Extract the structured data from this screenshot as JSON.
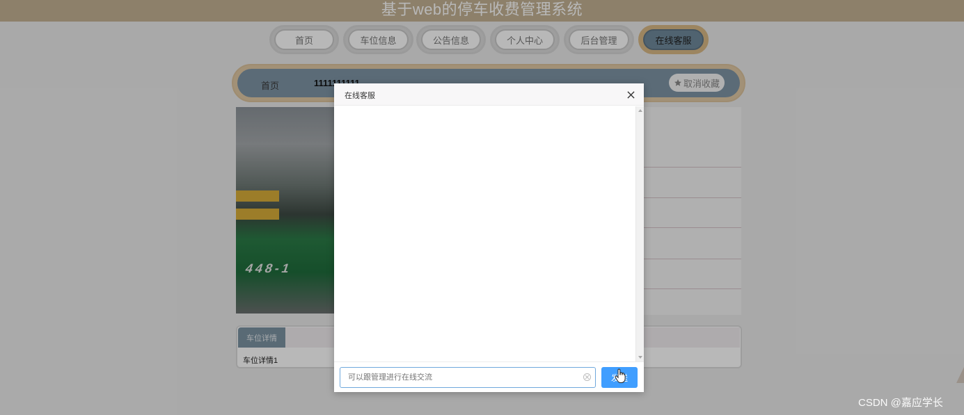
{
  "header": {
    "title": "基于web的停车收费管理系统"
  },
  "nav": {
    "items": [
      {
        "label": "首页",
        "active": false
      },
      {
        "label": "车位信息",
        "active": false
      },
      {
        "label": "公告信息",
        "active": false
      },
      {
        "label": "个人中心",
        "active": false
      },
      {
        "label": "后台管理",
        "active": false
      },
      {
        "label": "在线客服",
        "active": true
      }
    ]
  },
  "breadcrumb": {
    "home": "首页",
    "current": "1111111111"
  },
  "favorite": {
    "label": "取消收藏",
    "icon": "star-icon"
  },
  "photo": {
    "label": "448-1"
  },
  "detail": {
    "tab_label": "车位详情",
    "content": "车位详情1"
  },
  "dialog": {
    "title": "在线客服",
    "close_icon": "close-icon",
    "input_placeholder": "可以跟管理进行在线交流",
    "input_value": "",
    "send_label": "发送"
  },
  "watermark": "CSDN @嘉应学长",
  "colors": {
    "header": "#c4b294",
    "nav_active": "#6f8a9c",
    "send_button": "#409eff"
  }
}
